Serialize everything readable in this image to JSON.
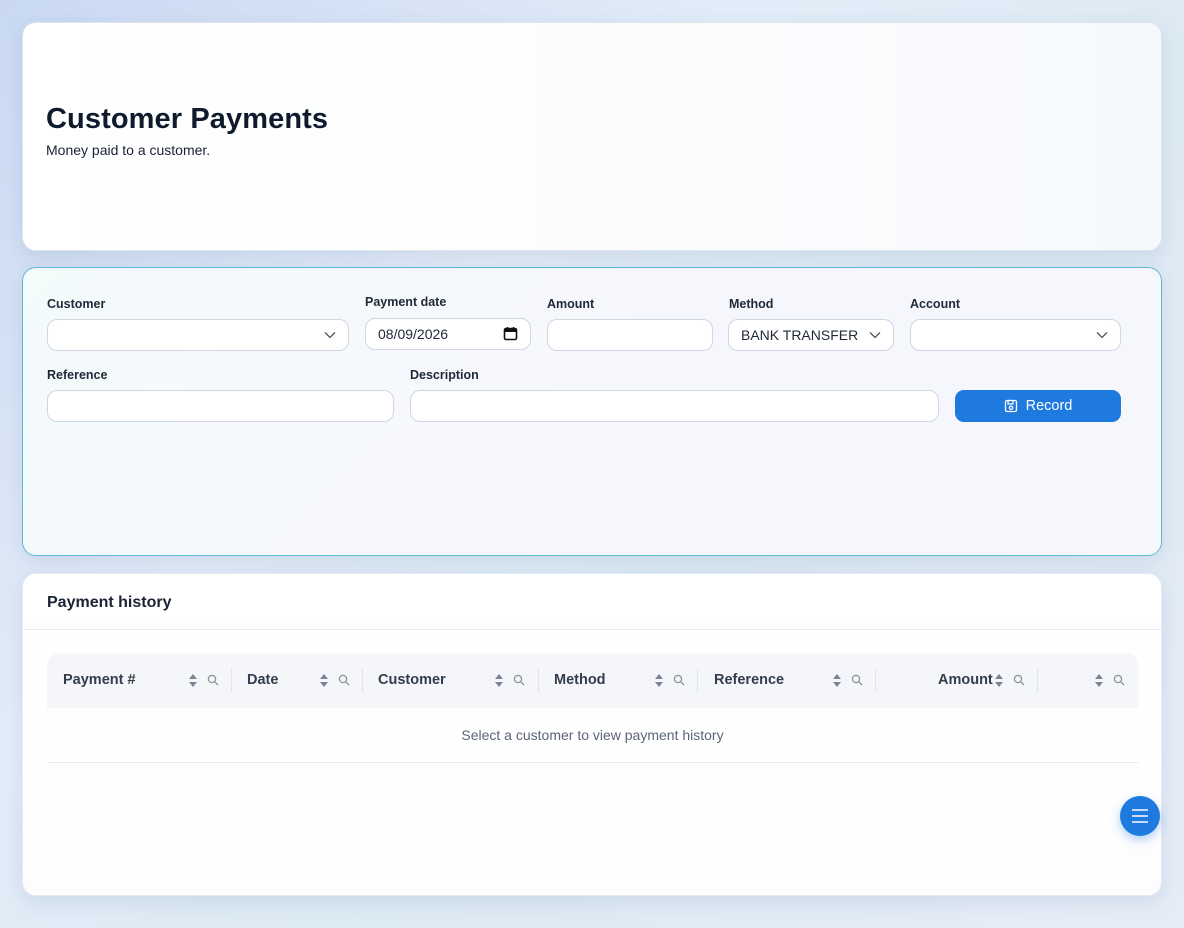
{
  "header": {
    "title": "Customer Payments",
    "subtitle": "Money paid to a customer."
  },
  "form": {
    "customer": {
      "label": "Customer",
      "value": ""
    },
    "payment_date": {
      "label": "Payment date",
      "value": "08/09/2026"
    },
    "amount": {
      "label": "Amount",
      "value": ""
    },
    "method": {
      "label": "Method",
      "value": "BANK TRANSFER"
    },
    "account": {
      "label": "Account",
      "value": ""
    },
    "reference": {
      "label": "Reference",
      "value": ""
    },
    "description": {
      "label": "Description",
      "value": ""
    },
    "record_button": "Record"
  },
  "history": {
    "title": "Payment history",
    "columns": [
      "Payment #",
      "Date",
      "Customer",
      "Method",
      "Reference",
      "Amount",
      ""
    ],
    "empty_message": "Select a customer to view payment history"
  },
  "colors": {
    "accent": "#1f7ae0",
    "form_border": "#5fb9d6"
  },
  "icons": {
    "dropdown": "chevron-down-icon",
    "calendar": "calendar-icon",
    "save": "save-icon",
    "sort": "sort-icon",
    "filter": "search-icon",
    "fab": "menu-icon"
  }
}
